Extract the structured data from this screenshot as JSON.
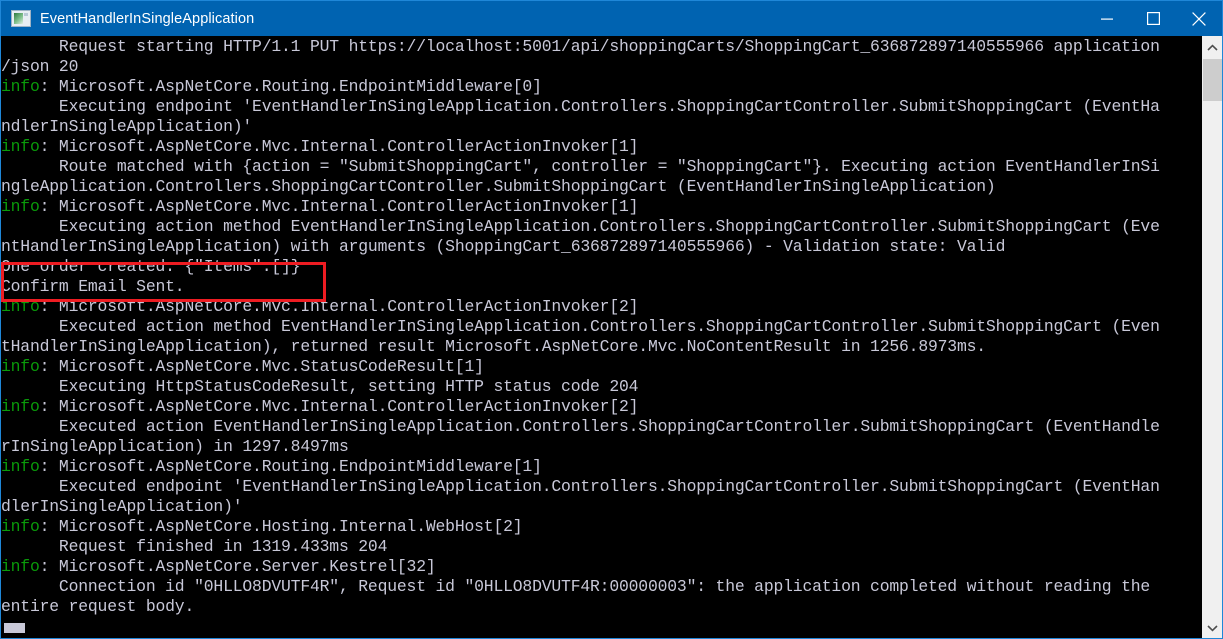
{
  "window": {
    "title": "EventHandlerInSingleApplication",
    "icon": "console-app-icon",
    "controls": {
      "minimize_label": "Minimize",
      "maximize_label": "Maximize",
      "close_label": "Close"
    },
    "titlebar_color": "#0063b1",
    "border_color": "#1f87d8"
  },
  "console": {
    "background_color": "#000000",
    "text_color": "#c8c8d8",
    "info_color": "#0a9a0a",
    "cursor": "block-cursor",
    "lines": [
      {
        "info": false,
        "text": "      Request starting HTTP/1.1 PUT https://localhost:5001/api/shoppingCarts/ShoppingCart_636872897140555966 application"
      },
      {
        "info": false,
        "text": "/json 20"
      },
      {
        "info": true,
        "text": "Microsoft.AspNetCore.Routing.EndpointMiddleware[0]"
      },
      {
        "info": false,
        "text": "      Executing endpoint 'EventHandlerInSingleApplication.Controllers.ShoppingCartController.SubmitShoppingCart (EventHa"
      },
      {
        "info": false,
        "text": "ndlerInSingleApplication)'"
      },
      {
        "info": true,
        "text": "Microsoft.AspNetCore.Mvc.Internal.ControllerActionInvoker[1]"
      },
      {
        "info": false,
        "text": "      Route matched with {action = \"SubmitShoppingCart\", controller = \"ShoppingCart\"}. Executing action EventHandlerInSi"
      },
      {
        "info": false,
        "text": "ngleApplication.Controllers.ShoppingCartController.SubmitShoppingCart (EventHandlerInSingleApplication)"
      },
      {
        "info": true,
        "text": "Microsoft.AspNetCore.Mvc.Internal.ControllerActionInvoker[1]"
      },
      {
        "info": false,
        "text": "      Executing action method EventHandlerInSingleApplication.Controllers.ShoppingCartController.SubmitShoppingCart (Eve"
      },
      {
        "info": false,
        "text": "ntHandlerInSingleApplication) with arguments (ShoppingCart_636872897140555966) - Validation state: Valid"
      },
      {
        "info": false,
        "text": "One order created: {\"Items\":[]}"
      },
      {
        "info": false,
        "text": "Confirm Email Sent."
      },
      {
        "info": true,
        "text": "Microsoft.AspNetCore.Mvc.Internal.ControllerActionInvoker[2]"
      },
      {
        "info": false,
        "text": "      Executed action method EventHandlerInSingleApplication.Controllers.ShoppingCartController.SubmitShoppingCart (Even"
      },
      {
        "info": false,
        "text": "tHandlerInSingleApplication), returned result Microsoft.AspNetCore.Mvc.NoContentResult in 1256.8973ms."
      },
      {
        "info": true,
        "text": "Microsoft.AspNetCore.Mvc.StatusCodeResult[1]"
      },
      {
        "info": false,
        "text": "      Executing HttpStatusCodeResult, setting HTTP status code 204"
      },
      {
        "info": true,
        "text": "Microsoft.AspNetCore.Mvc.Internal.ControllerActionInvoker[2]"
      },
      {
        "info": false,
        "text": "      Executed action EventHandlerInSingleApplication.Controllers.ShoppingCartController.SubmitShoppingCart (EventHandle"
      },
      {
        "info": false,
        "text": "rInSingleApplication) in 1297.8497ms"
      },
      {
        "info": true,
        "text": "Microsoft.AspNetCore.Routing.EndpointMiddleware[1]"
      },
      {
        "info": false,
        "text": "      Executed endpoint 'EventHandlerInSingleApplication.Controllers.ShoppingCartController.SubmitShoppingCart (EventHan"
      },
      {
        "info": false,
        "text": "dlerInSingleApplication)'"
      },
      {
        "info": true,
        "text": "Microsoft.AspNetCore.Hosting.Internal.WebHost[2]"
      },
      {
        "info": false,
        "text": "      Request finished in 1319.433ms 204"
      },
      {
        "info": true,
        "text": "Microsoft.AspNetCore.Server.Kestrel[32]"
      },
      {
        "info": false,
        "text": "      Connection id \"0HLLO8DVUTF4R\", Request id \"0HLLO8DVUTF4R:00000003\": the application completed without reading the"
      },
      {
        "info": false,
        "text": "entire request body."
      }
    ],
    "info_prefix": "info",
    "info_separator": ": "
  },
  "annotation": {
    "highlight_color": "#ee1c22",
    "highlighted_lines": [
      "One order created: {\"Items\":[]}",
      "Confirm Email Sent."
    ]
  },
  "scrollbar": {
    "up_arrow": "chevron-up-icon",
    "down_arrow": "chevron-down-icon",
    "thumb_color": "#cdcdcd",
    "track_color": "#f0f0f0"
  }
}
